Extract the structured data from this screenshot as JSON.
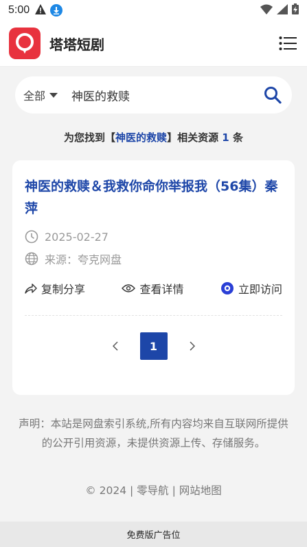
{
  "status_bar": {
    "time": "5:00"
  },
  "header": {
    "app_name": "塔塔短剧",
    "logo_icon": "chat-bubble-icon",
    "menu_icon": "menu-icon",
    "brand_color": "#e8323e"
  },
  "search": {
    "scope_label": "全部",
    "query": "神医的救赎",
    "search_icon": "search-icon"
  },
  "result_summary": {
    "prefix": "为您找到【",
    "keyword": "神医的救赎",
    "middle": "】相关资源 ",
    "count": "1",
    "suffix": " 条"
  },
  "results": [
    {
      "title": "神医的救赎＆我救你命你举报我（56集）秦萍",
      "date": "2025-02-27",
      "source": "来源：夸克网盘",
      "actions": {
        "share": "复制分享",
        "details": "查看详情",
        "visit": "立即访问"
      }
    }
  ],
  "pagination": {
    "current": "1"
  },
  "disclaimer": "声明：本站是网盘索引系统,所有内容均来自互联网所提供的公开引用资源，未提供资源上传、存储服务。",
  "footer": {
    "copyright": "© 2024",
    "sep1": " | ",
    "link1": "零导航",
    "sep2": " | ",
    "link2": "网站地图"
  },
  "ad_bar": "免费版广告位",
  "colors": {
    "accent": "#1d46a8",
    "brand": "#e8323e"
  }
}
